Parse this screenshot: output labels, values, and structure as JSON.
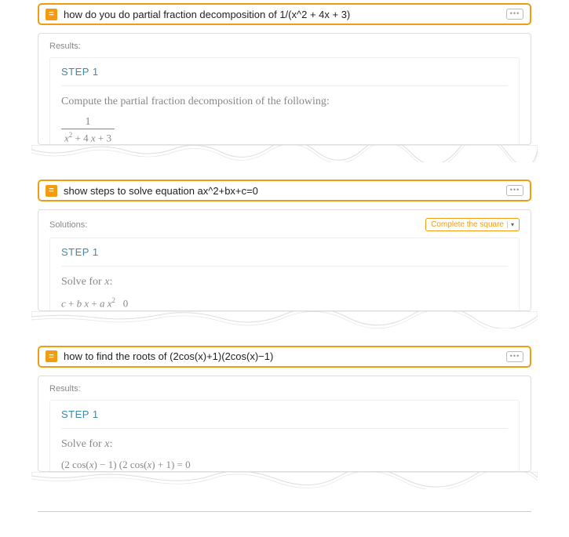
{
  "examples": [
    {
      "query": "how do you do partial fraction decomposition of 1/(x^2 + 4x + 3)",
      "section_label": "Results:",
      "step_label": "STEP 1",
      "instruction": "Compute the partial fraction decomposition of the following:",
      "fraction": {
        "numerator": "1",
        "denominator_display": "x² + 4 x + 3"
      },
      "method_button": null
    },
    {
      "query": "show steps to solve equation ax^2+bx+c=0",
      "section_label": "Solutions:",
      "step_label": "STEP 1",
      "instruction": "Solve for x:",
      "equation_display": "c + b x + a x²   0",
      "method_button": "Complete the square"
    },
    {
      "query": "how to find the roots of (2cos(x)+1)(2cos(x)−1)",
      "section_label": "Results:",
      "step_label": "STEP 1",
      "instruction": "Solve for x:",
      "equation_display": "(2 cos(x) − 1) (2 cos(x) + 1) = 0",
      "method_button": null
    }
  ],
  "icon_glyph": "=",
  "menu_glyph": "•••"
}
